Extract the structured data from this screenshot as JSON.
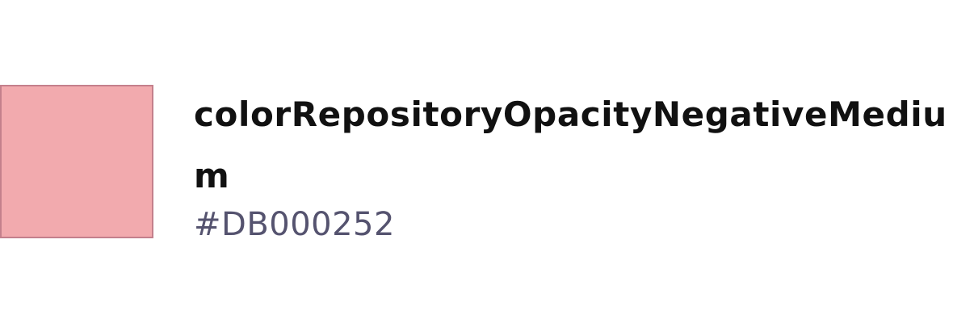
{
  "token": {
    "name": "colorRepositoryOpacityNegativeMedium",
    "value": "#DB000252",
    "swatch_fill": "#f2aaae",
    "swatch_border": "#c4808c"
  }
}
